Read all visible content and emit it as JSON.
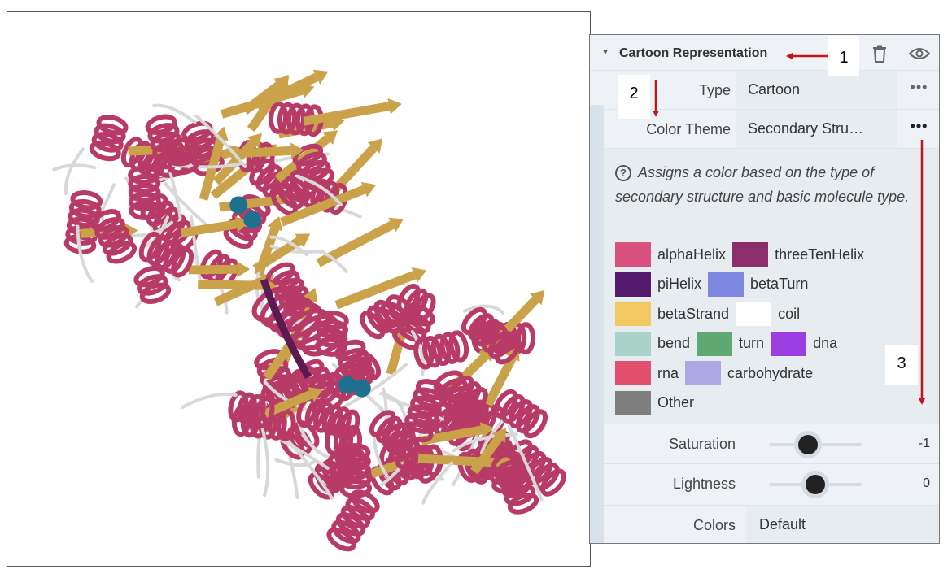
{
  "panel": {
    "title": "Cartoon Representation",
    "type_label": "Type",
    "type_value": "Cartoon",
    "color_theme_label": "Color Theme",
    "color_theme_value": "Secondary Stru…",
    "more_glyph": "•••",
    "description": "Assigns a color based on the type of secondary structure and basic molecule type.",
    "legend": [
      {
        "name": "alphaHelix",
        "color": "#d9527f"
      },
      {
        "name": "threeTenHelix",
        "color": "#8b2e6b"
      },
      {
        "name": "piHelix",
        "color": "#541a6e"
      },
      {
        "name": "betaTurn",
        "color": "#7b87e0"
      },
      {
        "name": "betaStrand",
        "color": "#f2c861"
      },
      {
        "name": "coil",
        "color": "#ffffff"
      },
      {
        "name": "bend",
        "color": "#a9d2c9"
      },
      {
        "name": "turn",
        "color": "#5ea873"
      },
      {
        "name": "dna",
        "color": "#9b3fe3"
      },
      {
        "name": "rna",
        "color": "#e34f6e"
      },
      {
        "name": "carbohydrate",
        "color": "#ada8e3"
      },
      {
        "name": "Other",
        "color": "#7f7f7f"
      }
    ],
    "saturation_label": "Saturation",
    "saturation_value": "-1",
    "saturation_level": -1,
    "lightness_label": "Lightness",
    "lightness_value": "0",
    "lightness_level": 0,
    "colors_label": "Colors",
    "colors_value": "Default"
  },
  "annotations": {
    "a1": "1",
    "a2": "2",
    "a3": "3"
  },
  "colors": {
    "helix": "#b83a66",
    "strand": "#c9a24a",
    "coil": "#d8d8d8",
    "ion": "#1f6f8f",
    "arrow": "#c0161a"
  },
  "icons": [
    "caret-down-icon",
    "trash-icon",
    "eye-icon",
    "help-circle-icon",
    "more-icon"
  ]
}
